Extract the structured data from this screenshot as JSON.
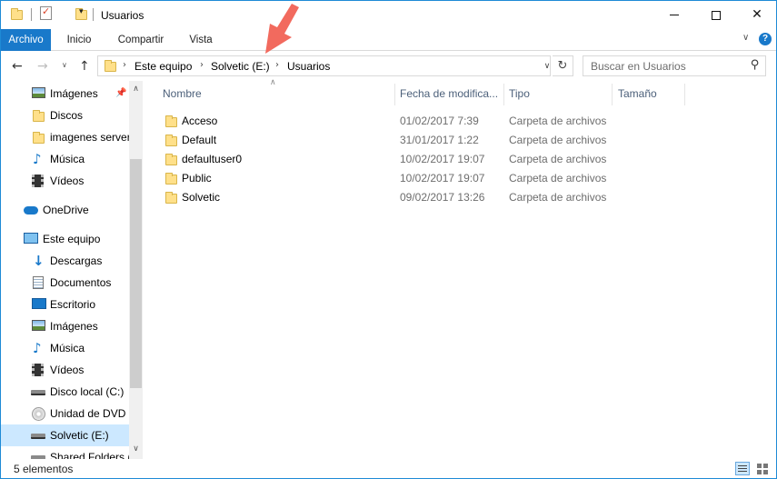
{
  "window": {
    "title": "Usuarios"
  },
  "ribbon": {
    "tabs": [
      {
        "label": "Archivo"
      },
      {
        "label": "Inicio"
      },
      {
        "label": "Compartir"
      },
      {
        "label": "Vista"
      }
    ]
  },
  "address": {
    "crumbs": [
      "Este equipo",
      "Solvetic (E:)",
      "Usuarios"
    ]
  },
  "search": {
    "placeholder": "Buscar en Usuarios"
  },
  "sidebar": {
    "items": [
      {
        "label": "Imágenes",
        "icon": "pictures-icon"
      },
      {
        "label": "Discos",
        "icon": "folder-icon"
      },
      {
        "label": "imagenes server",
        "icon": "folder-icon"
      },
      {
        "label": "Música",
        "icon": "music-icon"
      },
      {
        "label": "Vídeos",
        "icon": "videos-icon"
      },
      {
        "label": "OneDrive",
        "icon": "onedrive-icon"
      },
      {
        "label": "Este equipo",
        "icon": "this-pc-icon"
      },
      {
        "label": "Descargas",
        "icon": "downloads-icon"
      },
      {
        "label": "Documentos",
        "icon": "documents-icon"
      },
      {
        "label": "Escritorio",
        "icon": "desktop-icon"
      },
      {
        "label": "Imágenes",
        "icon": "pictures-icon"
      },
      {
        "label": "Música",
        "icon": "music-icon"
      },
      {
        "label": "Vídeos",
        "icon": "videos-icon"
      },
      {
        "label": "Disco local (C:)",
        "icon": "drive-icon"
      },
      {
        "label": "Unidad de DVD (",
        "icon": "dvd-icon"
      },
      {
        "label": "Solvetic (E:)",
        "icon": "drive-icon"
      },
      {
        "label": "Shared Folders (",
        "icon": "drive-icon"
      }
    ]
  },
  "columns": {
    "name": "Nombre",
    "date": "Fecha de modifica...",
    "type": "Tipo",
    "size": "Tamaño"
  },
  "files": [
    {
      "name": "Acceso",
      "date": "01/02/2017 7:39",
      "type": "Carpeta de archivos"
    },
    {
      "name": "Default",
      "date": "31/01/2017 1:22",
      "type": "Carpeta de archivos"
    },
    {
      "name": "defaultuser0",
      "date": "10/02/2017 19:07",
      "type": "Carpeta de archivos"
    },
    {
      "name": "Public",
      "date": "10/02/2017 19:07",
      "type": "Carpeta de archivos"
    },
    {
      "name": "Solvetic",
      "date": "09/02/2017 13:26",
      "type": "Carpeta de archivos"
    }
  ],
  "status": {
    "count": "5 elementos"
  },
  "colors": {
    "accent": "#1979ca",
    "selected": "#cce8ff",
    "annotation": "#f26a5e"
  }
}
